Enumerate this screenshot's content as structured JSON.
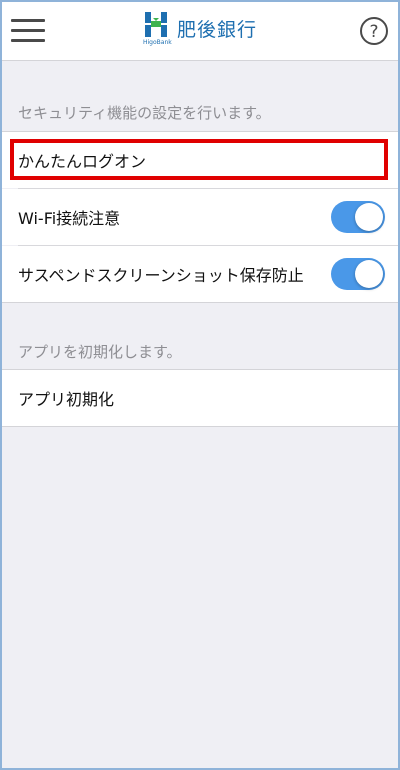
{
  "header": {
    "logo_text": "肥後銀行",
    "logo_sub": "HigoBank",
    "accent_color": "#1e6fb0",
    "menu_icon": "hamburger-menu-icon",
    "help_icon": "question-circle-icon"
  },
  "security_section": {
    "header": "セキュリティ機能の設定を行います。",
    "items": [
      {
        "label": "かんたんログオン"
      },
      {
        "label": "Wi-Fi接続注意",
        "toggle": true
      },
      {
        "label": "サスペンドスクリーンショット保存防止",
        "toggle": true
      }
    ]
  },
  "init_section": {
    "header": "アプリを初期化します。",
    "items": [
      {
        "label": "アプリ初期化"
      }
    ]
  },
  "toggle_on_color": "#4a98e8",
  "highlight_color": "#e00000"
}
